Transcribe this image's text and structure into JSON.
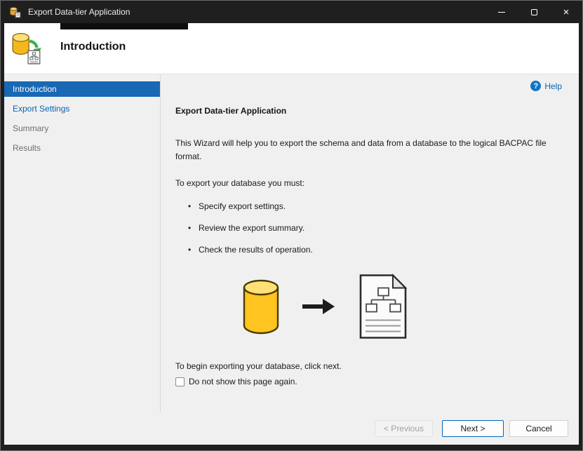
{
  "colors": {
    "titlebar_bg": "#1f1f1f",
    "selected_item_bg": "#1868b5",
    "link_blue": "#0a62ad",
    "database_yellow": "#ffc41f",
    "arrow_green": "#3fae49",
    "next_button_border": "#0067c0"
  },
  "window": {
    "title": "Export Data-tier Application",
    "icons": {
      "close": "×"
    }
  },
  "header": {
    "title": "Introduction"
  },
  "sidebar": {
    "items": [
      {
        "label": "Introduction",
        "state": "selected"
      },
      {
        "label": "Export Settings",
        "state": "link"
      },
      {
        "label": "Summary",
        "state": "pending"
      },
      {
        "label": "Results",
        "state": "pending"
      }
    ]
  },
  "content": {
    "help": {
      "label": "Help",
      "icon_glyph": "?"
    },
    "heading": "Export Data-tier Application",
    "intro": "This Wizard will help you to export the schema and data from a database to the logical BACPAC file format.",
    "requirements_label": "To export your database you must:",
    "bullets": [
      "Specify export settings.",
      "Review the export summary.",
      "Check the results of operation."
    ],
    "begin_text": "To begin exporting your database, click next.",
    "checkbox": {
      "label": "Do not show this page again.",
      "checked": false
    }
  },
  "footer": {
    "buttons": [
      {
        "label": "< Previous",
        "state": "disabled"
      },
      {
        "label": "Next >",
        "state": "default"
      },
      {
        "label": "Cancel",
        "state": "enabled"
      }
    ]
  }
}
